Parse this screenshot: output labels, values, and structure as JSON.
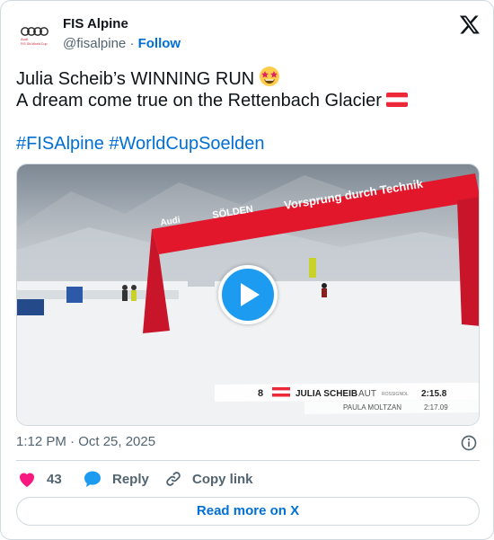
{
  "author": {
    "name": "FIS Alpine",
    "handle": "@fisalpine",
    "separator": "·",
    "follow_label": "Follow",
    "avatar_text_1": "Audi",
    "avatar_text_2": "FIS Ski World Cup"
  },
  "post": {
    "line1": "Julia Scheib’s WINNING RUN",
    "line2": "A dream come true on the Rettenbach Glacier",
    "hashtag1": "#FISAlpine",
    "hashtag2": "#WorldCupSoelden",
    "emoji1": "star-struck-emoji",
    "emoji2": "austria-flag-emoji"
  },
  "video": {
    "banner_brand": "Audi",
    "banner_location": "SÖLDEN",
    "banner_slogan": "Vorsprung durch Technik",
    "lower_third": {
      "rank": "8",
      "athlete": "JULIA SCHEIB",
      "nation": "AUT",
      "ski_brand": "ROSSIGNOL",
      "time": "2:15.8",
      "leader": "PAULA MOLTZAN",
      "leader_time": "2:17.09"
    },
    "play_icon": "play-icon"
  },
  "timestamp": "1:12 PM · Oct 25, 2025",
  "actions": {
    "like_count": "43",
    "reply_label": "Reply",
    "copy_label": "Copy link"
  },
  "read_more_label": "Read more on X",
  "colors": {
    "link": "#006fd6",
    "like": "#f91880",
    "reply": "#1d9bf0",
    "border": "#cfd9de",
    "muted": "#536471",
    "banner_red": "#e2172b"
  }
}
